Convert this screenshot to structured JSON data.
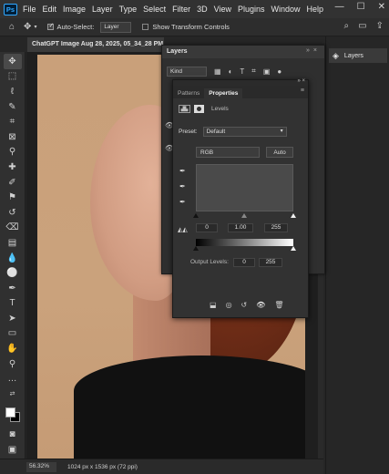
{
  "app": {
    "logo": "Ps"
  },
  "menu": [
    "File",
    "Edit",
    "Image",
    "Layer",
    "Type",
    "Select",
    "Filter",
    "3D",
    "View",
    "Plugins",
    "Window",
    "Help"
  ],
  "window_controls": {
    "minimize": "—",
    "maximize": "☐",
    "close": "✕"
  },
  "options_bar": {
    "auto_select_label": "Auto-Select:",
    "auto_select_checked": true,
    "auto_select_target": "Layer",
    "show_transform_label": "Show Transform Controls"
  },
  "document": {
    "tab_title": "ChatGPT Image Aug 28, 2025, 05_34_28 PM",
    "zoom": "56.32%",
    "info": "1024 px x 1536 px (72 ppi)"
  },
  "right_dock": {
    "layers_label": "Layers"
  },
  "layers_panel": {
    "title": "Layers",
    "kind_label": "Kind"
  },
  "properties_panel": {
    "tabs": [
      {
        "label": "Patterns",
        "active": false
      },
      {
        "label": "Properties",
        "active": true
      }
    ],
    "adjustment_name": "Levels",
    "preset_label": "Preset:",
    "preset_value": "Default",
    "channel": "RGB",
    "auto_label": "Auto",
    "input_levels": {
      "black": "0",
      "gamma": "1.00",
      "white": "255"
    },
    "output_label": "Output Levels:",
    "output_levels": {
      "black": "0",
      "white": "255"
    }
  },
  "colors": {
    "accent": "#31a8ff",
    "panel": "#323232",
    "background": "#262626"
  }
}
